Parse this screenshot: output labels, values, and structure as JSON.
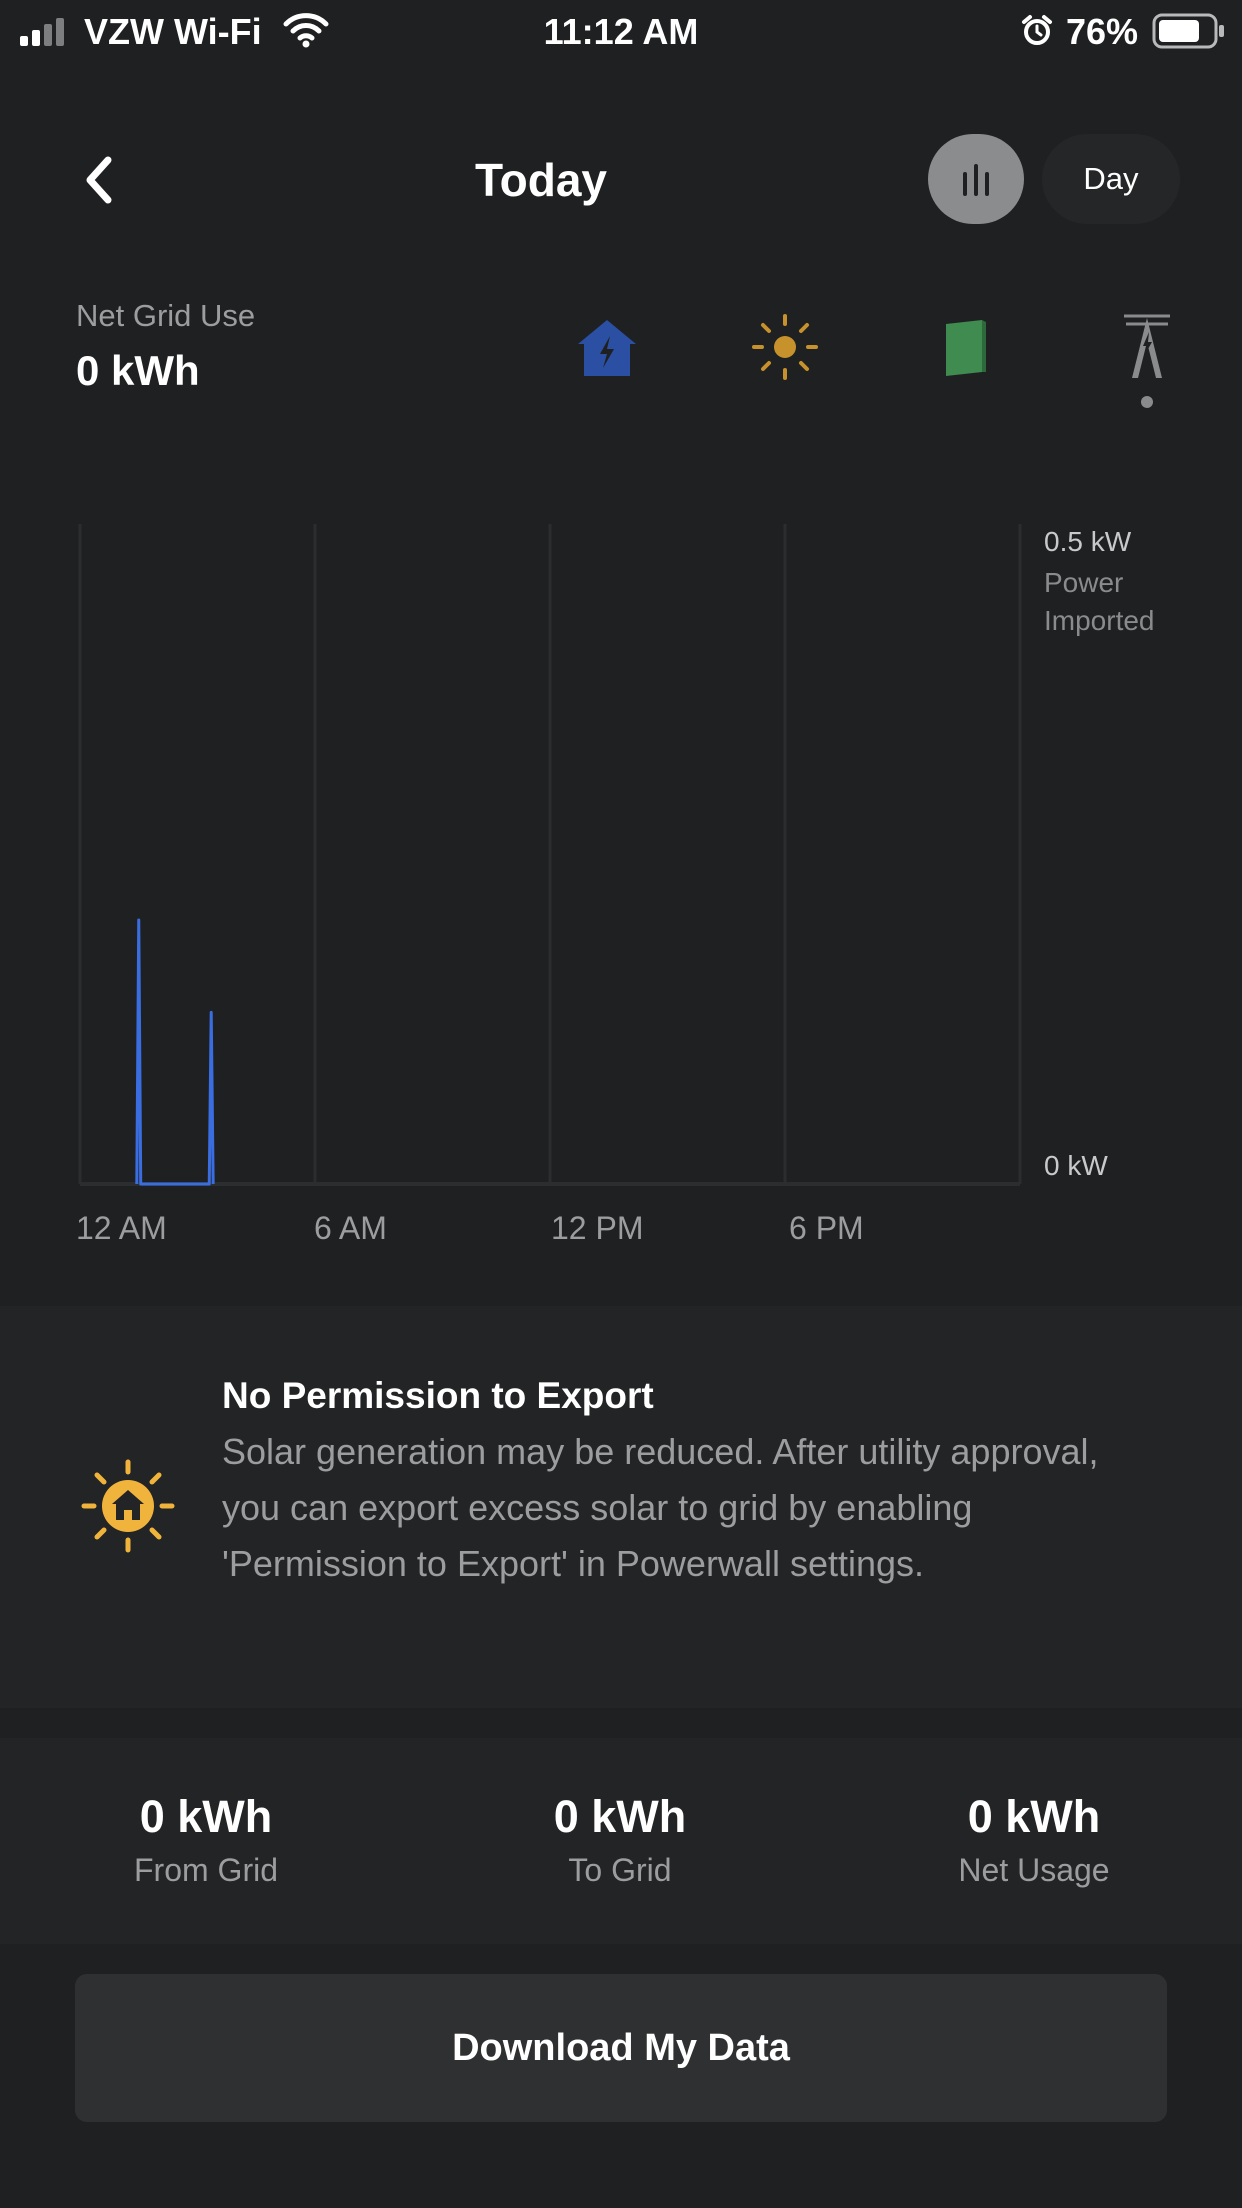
{
  "status_bar": {
    "carrier": "VZW Wi-Fi",
    "time": "11:12 AM",
    "battery": "76%"
  },
  "header": {
    "title": "Today",
    "period_label": "Day"
  },
  "summary": {
    "label": "Net Grid Use",
    "value": "0 kWh"
  },
  "source_icons": [
    "home-icon",
    "sun-icon",
    "powerwall-icon",
    "grid-tower-icon"
  ],
  "colors": {
    "home": "#2a4fa3",
    "solar": "#c7912c",
    "powerwall": "#3f8b50",
    "grid": "#8a8b8c",
    "series": "#3a6de0",
    "notice_icon": "#f0b43c"
  },
  "chart_data": {
    "type": "line",
    "xlabel": "",
    "ylabel": "Power Imported",
    "x_ticks": [
      "12 AM",
      "6 AM",
      "12 PM",
      "6 PM"
    ],
    "y_top_label": "0.5 kW",
    "y_bottom_label": "0 kW",
    "ylim": [
      0,
      0.5
    ],
    "xlim_hours": [
      0,
      24
    ],
    "series": [
      {
        "x": [
          1.45,
          1.5,
          1.55,
          3.3,
          3.35,
          3.4
        ],
        "y": [
          0,
          0.2,
          0,
          0,
          0.13,
          0
        ]
      }
    ]
  },
  "notice": {
    "title": "No Permission to Export",
    "body": "Solar generation may be reduced. After utility approval, you can export excess solar to grid by enabling 'Permission to Export' in Powerwall settings."
  },
  "stats": [
    {
      "value": "0 kWh",
      "label": "From Grid"
    },
    {
      "value": "0 kWh",
      "label": "To Grid"
    },
    {
      "value": "0 kWh",
      "label": "Net Usage"
    }
  ],
  "download_label": "Download My Data"
}
